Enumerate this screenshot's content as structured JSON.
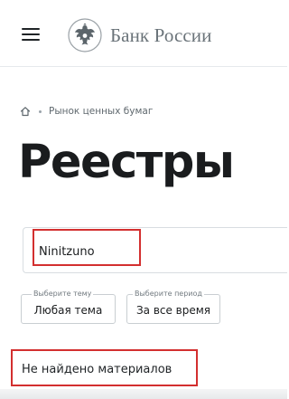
{
  "header": {
    "menu_icon": "hamburger-menu-icon",
    "logo_icon": "bank-of-russia-emblem-icon",
    "logo_text": "Банк России"
  },
  "breadcrumb": {
    "home_icon": "home-icon",
    "items": [
      {
        "label": "Рынок ценных бумаг"
      }
    ]
  },
  "page": {
    "title": "Реестры"
  },
  "search": {
    "value": "Ninitzuno",
    "placeholder": ""
  },
  "filters": {
    "theme": {
      "legend": "Выберите тему",
      "value": "Любая тема"
    },
    "period": {
      "legend": "Выберите период",
      "value": "За все время"
    }
  },
  "results": {
    "empty_message": "Не найдено материалов"
  },
  "colors": {
    "highlight": "#d32f2f",
    "logo_gray": "#6a7379",
    "text": "#1f2326"
  }
}
